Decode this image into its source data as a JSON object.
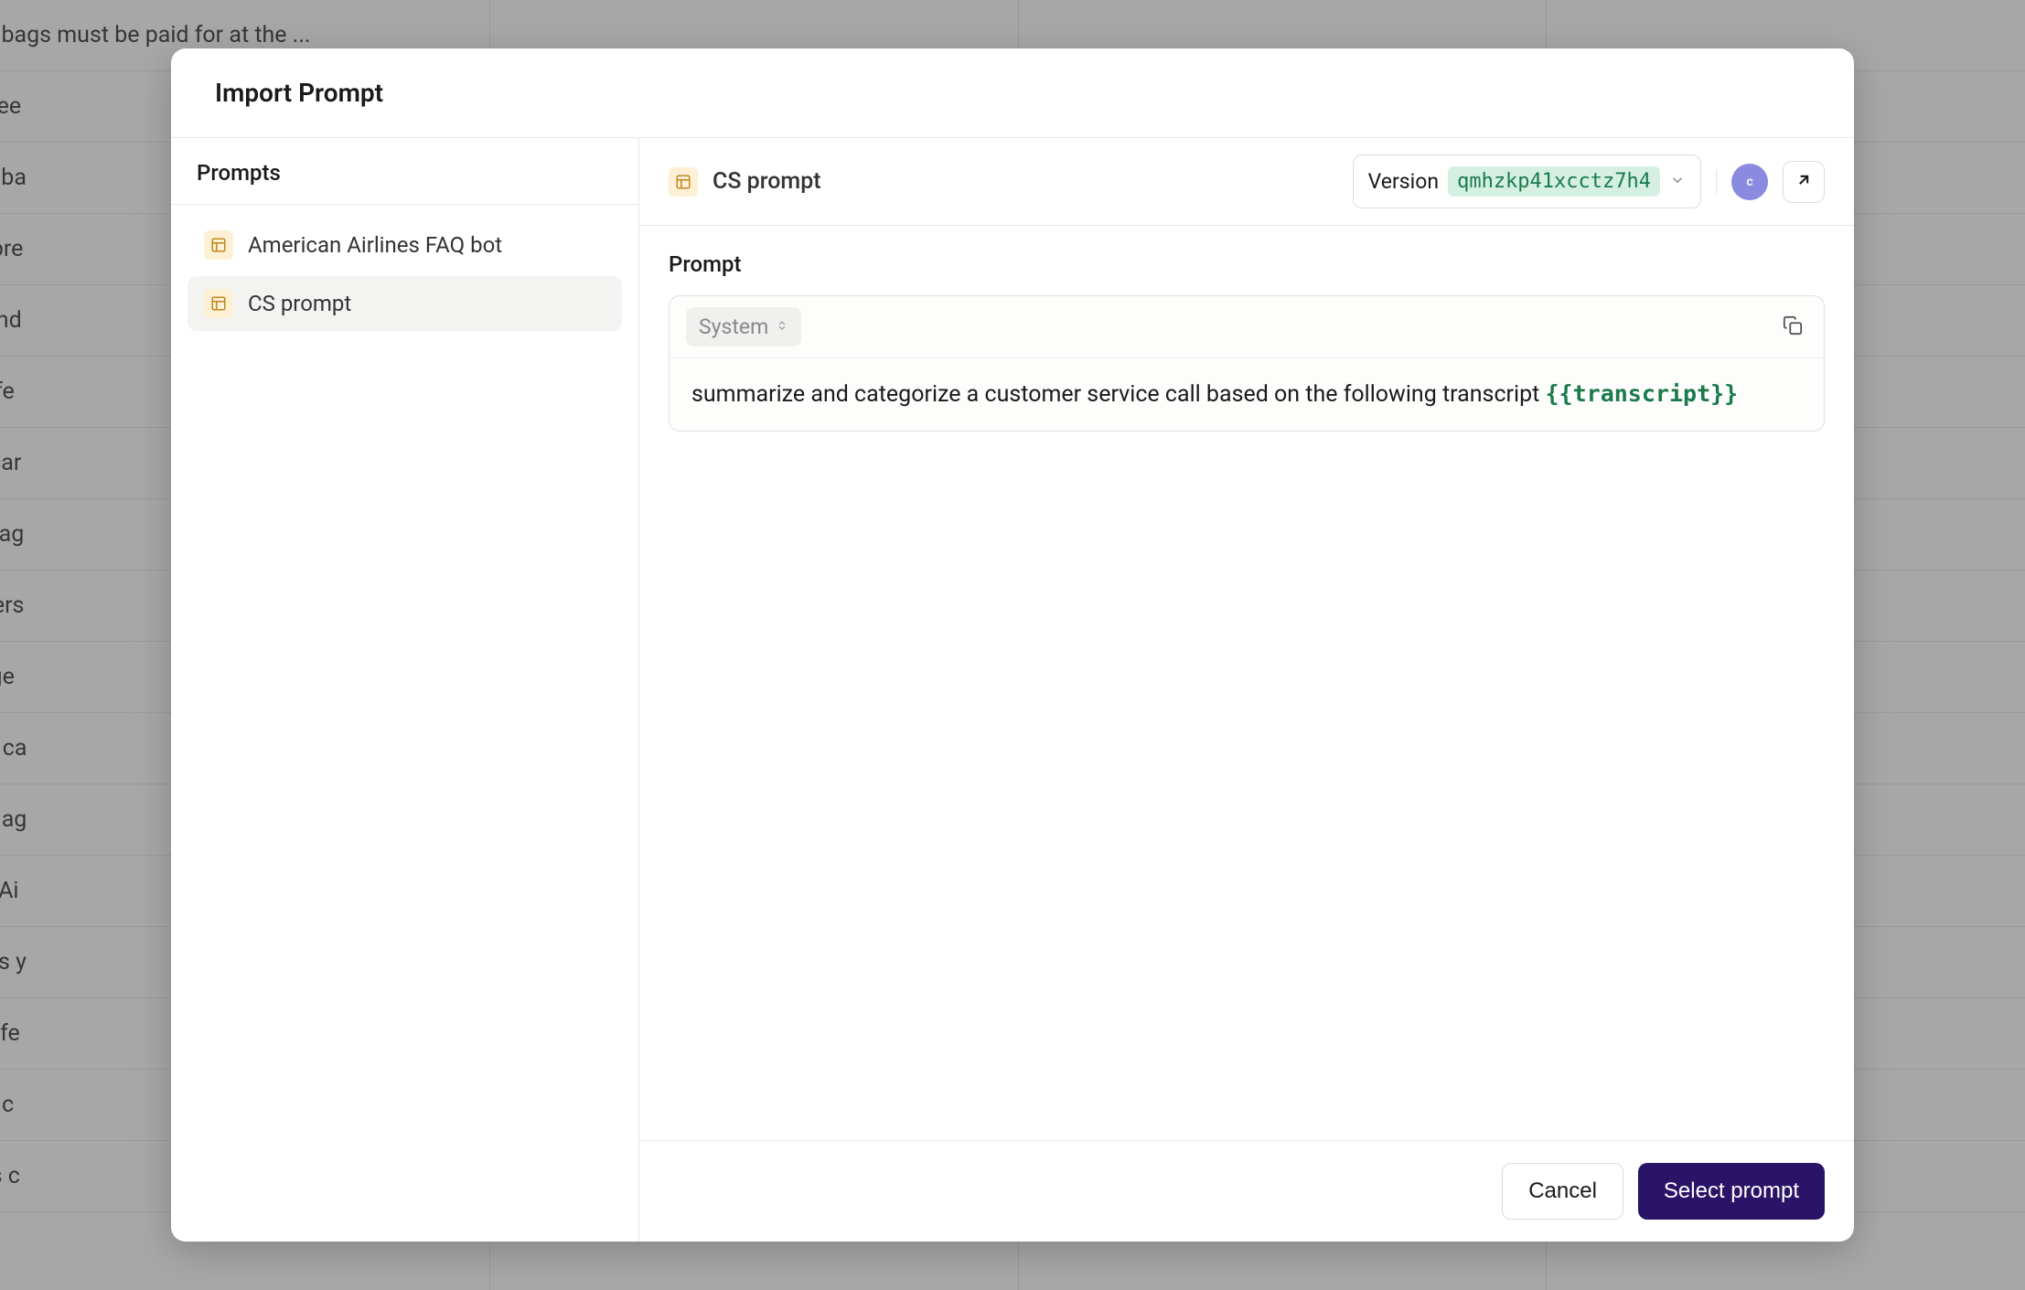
{
  "modal": {
    "title": "Import Prompt"
  },
  "sidebar": {
    "header": "Prompts",
    "items": [
      {
        "label": "American Airlines FAQ bot",
        "selected": false
      },
      {
        "label": "CS prompt",
        "selected": true
      }
    ]
  },
  "content": {
    "title": "CS prompt",
    "version_label": "Version",
    "version_id": "qmhzkp41xcctz7h4",
    "avatar_initial": "c",
    "section_label": "Prompt",
    "role": "System",
    "prompt_text": "summarize and categorize a customer service call based on the following transcript ",
    "template_var": "{{transcript}}"
  },
  "footer": {
    "cancel_label": "Cancel",
    "select_label": "Select prompt"
  },
  "background": {
    "rows": [
      "o, additional bags must be paid for at the ...",
      "o, baggage fee",
      "es, your free ba",
      "es, you can pre",
      "tandard refund",
      "o, pet travel fe",
      "o, baggage car",
      "o, checked bag",
      "es, passengers",
      "nline baggage",
      "aggage fees ca",
      "o, once baggag",
      "o, American Ai",
      "es, as long as y",
      "es, baggage fe",
      "your flight is c",
      "et travel fees c"
    ]
  }
}
